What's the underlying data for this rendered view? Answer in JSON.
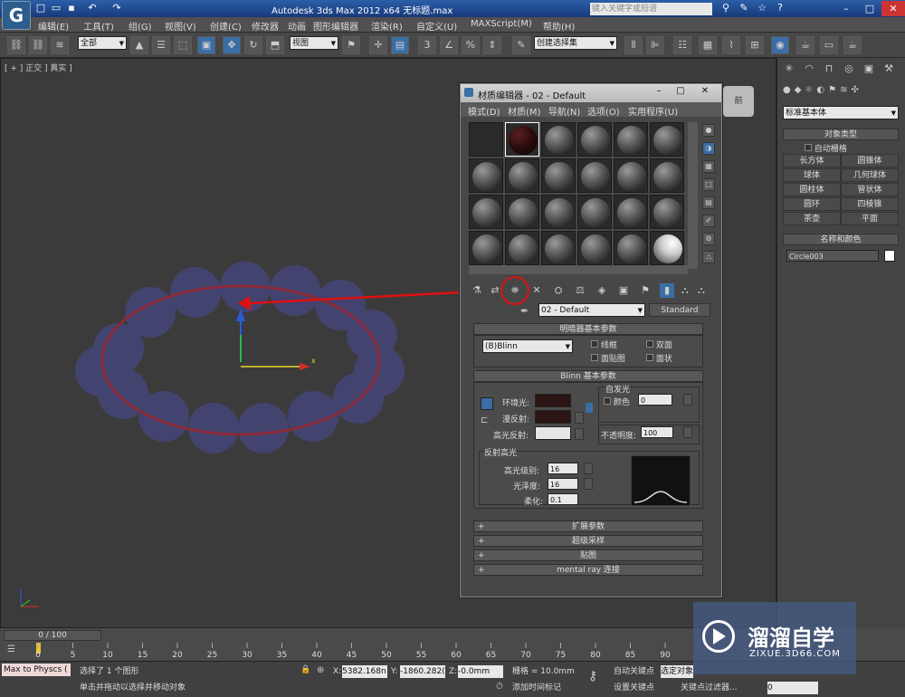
{
  "titlebar": {
    "title": "Autodesk 3ds Max  2012 x64      无标题.max",
    "search_placeholder": "键入关键字或短语",
    "app_icon": "3ds-max-icon"
  },
  "menu": [
    "编辑(E)",
    "工具(T)",
    "组(G)",
    "视图(V)",
    "创建(C)",
    "修改器",
    "动画",
    "图形编辑器",
    "渲染(R)",
    "自定义(U)",
    "MAXScript(M)",
    "帮助(H)"
  ],
  "toolbar": {
    "selection_filter": "全部",
    "ref_coord": "视图",
    "named_selection": "创建选择集"
  },
  "viewport": {
    "label": "[ + ] 正交 ] 真实 ]",
    "axis_x": "x"
  },
  "command_panel": {
    "category": "标准基本体",
    "object_type_header": "对象类型",
    "autogrid": "自动栅格",
    "objects": [
      "长方体",
      "圆锥体",
      "球体",
      "几何球体",
      "圆柱体",
      "管状体",
      "圆环",
      "四棱锥",
      "茶壶",
      "平面"
    ],
    "name_color_header": "名称和颜色",
    "object_name": "Circle003"
  },
  "material_editor": {
    "title": "材质编辑器 - 02 - Default",
    "menu": [
      "模式(D)",
      "材质(M)",
      "导航(N)",
      "选项(O)",
      "实用程序(U)"
    ],
    "material_name": "02 - Default",
    "material_type": "Standard",
    "shader_header": "明暗器基本参数",
    "shader": "(B)Blinn",
    "wire": "线框",
    "two_sided": "双面",
    "face_map": "面贴图",
    "faceted": "面状",
    "blinn_header": "Blinn 基本参数",
    "self_illum": "自发光",
    "color_label": "颜色",
    "color_value": "0",
    "ambient": "环境光:",
    "diffuse": "漫反射:",
    "specular": "高光反射:",
    "opacity_label": "不透明度:",
    "opacity_value": "100",
    "spec_highlights": "反射高光",
    "spec_level_label": "高光级别:",
    "spec_level": "16",
    "glossiness_label": "光泽度:",
    "glossiness": "16",
    "soften_label": "柔化:",
    "soften": "0.1",
    "rollouts": [
      "扩展参数",
      "超级采样",
      "贴图",
      "mental ray 连接"
    ],
    "colors": {
      "ambient": "#2a1414",
      "diffuse": "#2a1414",
      "specular": "#e6e6e6"
    }
  },
  "timeline": {
    "frame": "0 / 100",
    "ticks": [
      "0",
      "5",
      "10",
      "15",
      "20",
      "25",
      "30",
      "35",
      "40",
      "45",
      "50",
      "55",
      "60",
      "65",
      "70",
      "75",
      "80",
      "85",
      "90"
    ]
  },
  "status": {
    "script_btn": "Max to Physcs (",
    "selected": "选择了 1 个图形",
    "prompt": "单击并拖动以选择并移动对象",
    "x_label": "X:",
    "x": "5382.168n",
    "y_label": "Y:",
    "y": "-1860.282(",
    "z_label": "Z:",
    "z": "-0.0mm",
    "grid": "栅格 = 10.0mm",
    "add_time_tag": "添加时间标记",
    "auto_key": "自动关键点",
    "set_key": "设置关键点",
    "selected_object": "选定对象",
    "key_filter": "关键点过滤器...",
    "frame_value": "0"
  },
  "watermark": {
    "brand": "溜溜自学",
    "url": "ZIXUE.3D66.COM"
  }
}
